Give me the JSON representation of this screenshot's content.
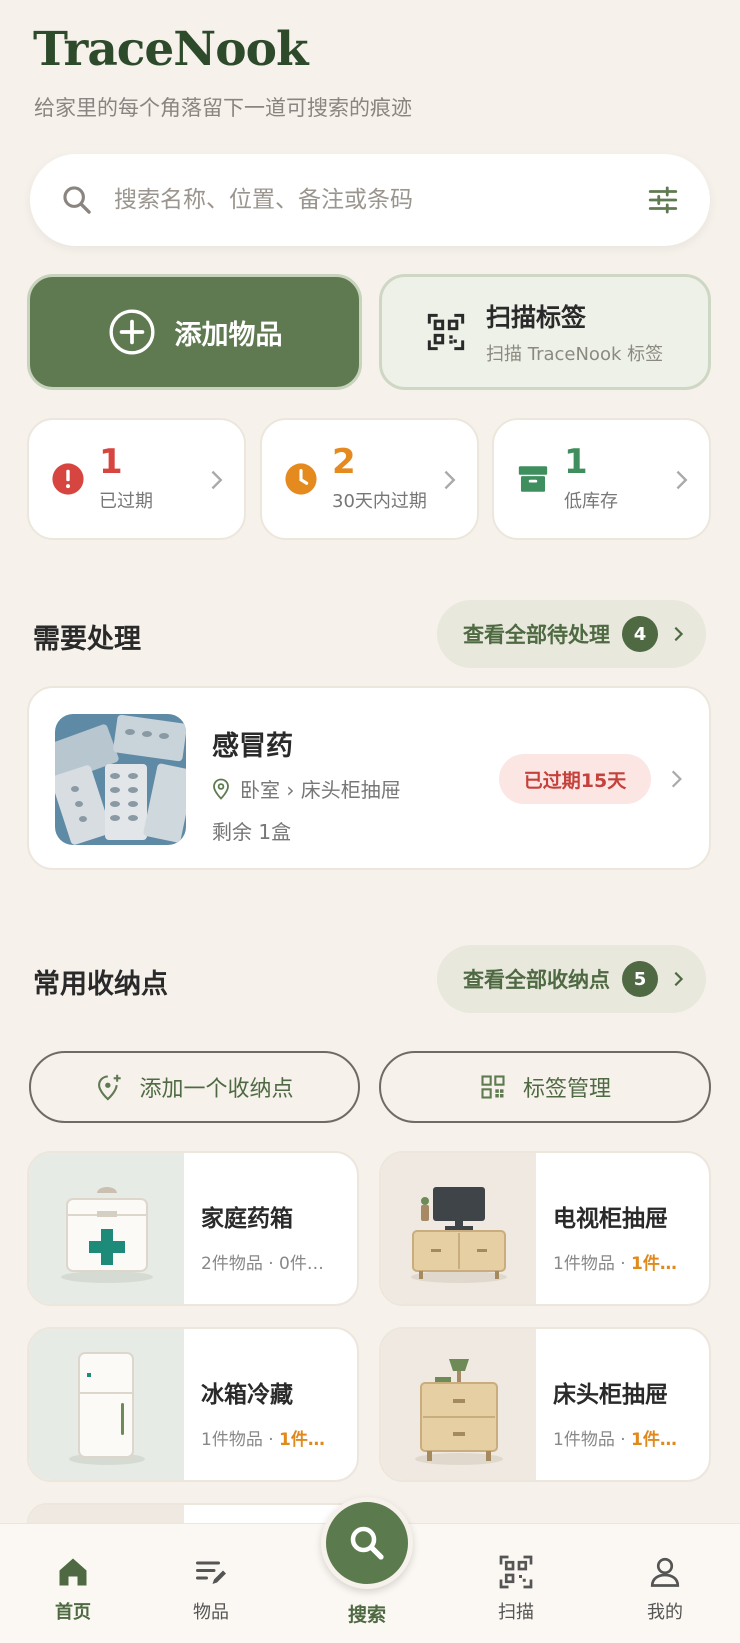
{
  "header": {
    "brand": "TraceNook",
    "tagline": "给家里的每个角落留下一道可搜索的痕迹"
  },
  "search": {
    "placeholder": "搜索名称、位置、备注或条码"
  },
  "actions": {
    "add_label": "添加物品",
    "scan_title": "扫描标签",
    "scan_subtitle": "扫描 TraceNook 标签"
  },
  "stats": [
    {
      "value": "1",
      "label": "已过期",
      "color": "#d6453f"
    },
    {
      "value": "2",
      "label": "30天内过期",
      "color": "#e58a1f"
    },
    {
      "value": "1",
      "label": "低库存",
      "color": "#3f8f5e"
    }
  ],
  "attention": {
    "title": "需要处理",
    "view_all_label": "查看全部待处理",
    "count": "4",
    "item": {
      "name": "感冒药",
      "location": "卧室 › 床头柜抽屉",
      "quantity": "剩余 1盒",
      "badge": "已过期15天"
    }
  },
  "locations": {
    "title": "常用收纳点",
    "view_all_label": "查看全部收纳点",
    "count": "5",
    "add_label": "添加一个收纳点",
    "tags_label": "标签管理",
    "cards": [
      {
        "name": "家庭药箱",
        "meta": "2件物品 · 0件…",
        "warn": ""
      },
      {
        "name": "电视柜抽屉",
        "meta": "1件物品 · ",
        "warn": "1件…"
      },
      {
        "name": "冰箱冷藏",
        "meta": "1件物品 · ",
        "warn": "1件…"
      },
      {
        "name": "床头柜抽屉",
        "meta": "1件物品 · ",
        "warn": "1件…"
      }
    ]
  },
  "nav": {
    "home": "首页",
    "items": "物品",
    "search": "搜索",
    "scan": "扫描",
    "me": "我的"
  },
  "colors": {
    "brand": "#2d4a2b",
    "primary": "#5f7a51",
    "expired": "#d6453f",
    "expiring": "#e58a1f",
    "low_stock": "#3f8f5e"
  }
}
